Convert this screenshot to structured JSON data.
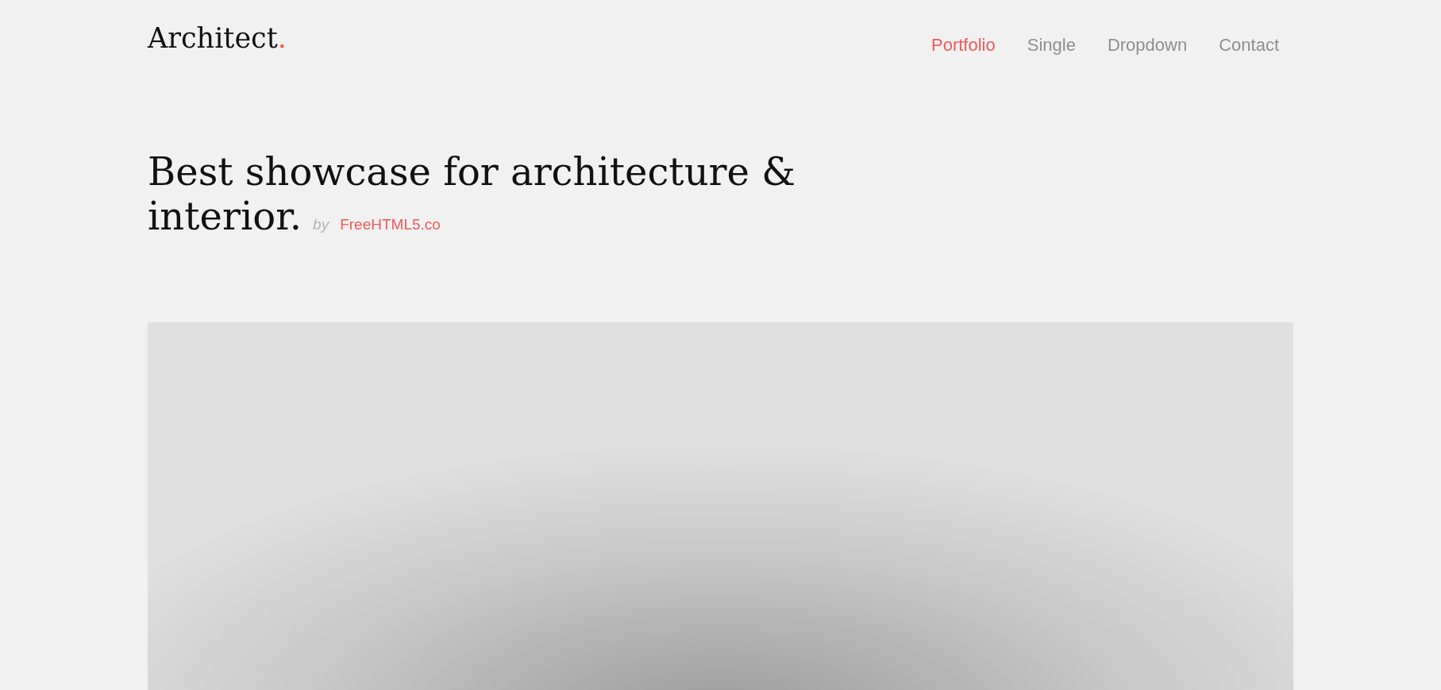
{
  "logo": {
    "text": "Architect",
    "mark": "."
  },
  "nav": [
    {
      "label": "Portfolio",
      "selected": true
    },
    {
      "label": "Single",
      "selected": false
    },
    {
      "label": "Dropdown",
      "selected": false
    },
    {
      "label": "Contact",
      "selected": false
    }
  ],
  "hero": {
    "title_line_1": "Best showcase for architecture &",
    "title_line_2": "interior.",
    "by": "by",
    "author": "FreeHTML5.co"
  }
}
